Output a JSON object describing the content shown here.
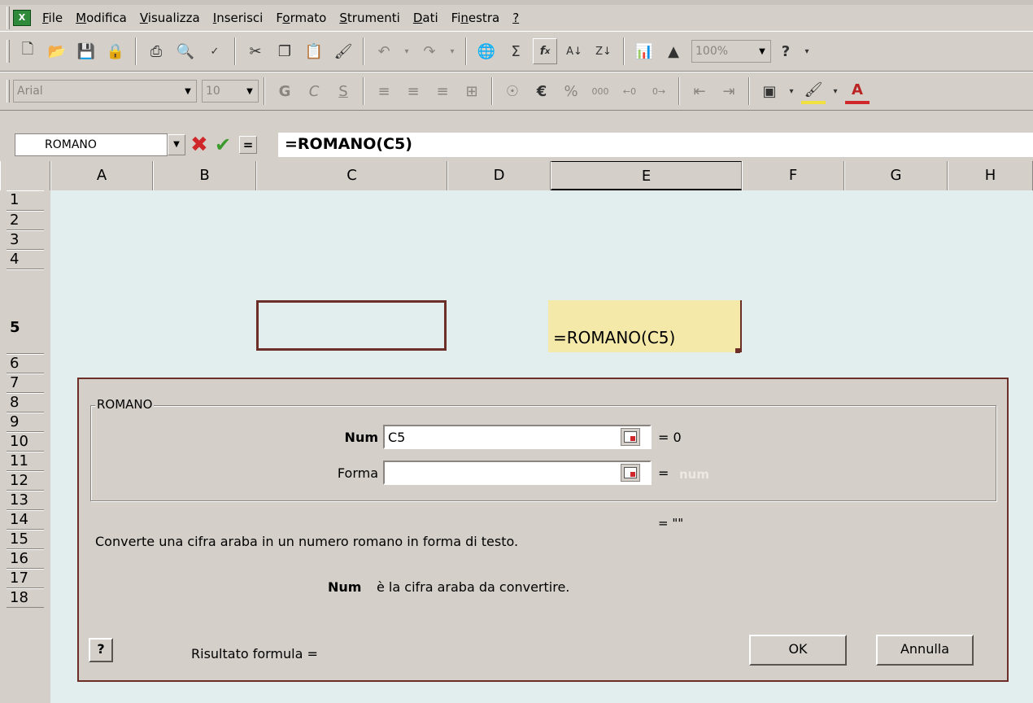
{
  "menu": {
    "items": [
      {
        "prefix": "",
        "underline": "F",
        "rest": "ile"
      },
      {
        "prefix": "",
        "underline": "M",
        "rest": "odifica"
      },
      {
        "prefix": "",
        "underline": "V",
        "rest": "isualizza"
      },
      {
        "prefix": "",
        "underline": "I",
        "rest": "nserisci"
      },
      {
        "prefix": "F",
        "underline": "o",
        "rest": "rmato"
      },
      {
        "prefix": "",
        "underline": "S",
        "rest": "trumenti"
      },
      {
        "prefix": "",
        "underline": "D",
        "rest": "ati"
      },
      {
        "prefix": "Fi",
        "underline": "n",
        "rest": "estra"
      },
      {
        "prefix": "",
        "underline": "?",
        "rest": ""
      }
    ]
  },
  "toolbar1": {
    "zoom": "100%",
    "icons": [
      "new-icon",
      "open-icon",
      "save-icon",
      "permission-icon",
      "print-icon",
      "print-preview-icon",
      "spelling-icon",
      "cut-icon",
      "copy-icon",
      "paste-icon",
      "format-painter-icon",
      "undo-icon",
      "redo-icon",
      "hyperlink-icon",
      "autosum-icon",
      "function-icon",
      "sort-ascending-icon",
      "sort-descending-icon",
      "chart-wizard-icon",
      "drawing-icon",
      "help-icon"
    ]
  },
  "toolbar2": {
    "font": "Arial",
    "size": "10",
    "bold": "G",
    "italic": "C",
    "underline": "S",
    "euro": "€",
    "percent": "%",
    "thousands": "000"
  },
  "formula_bar": {
    "name_box": "ROMANO",
    "equals": "=",
    "formula": "=ROMANO(C5)"
  },
  "grid": {
    "columns": [
      "A",
      "B",
      "C",
      "D",
      "E",
      "F",
      "G",
      "H"
    ],
    "rows": [
      "1",
      "2",
      "3",
      "4",
      "5",
      "6",
      "7",
      "8",
      "9",
      "10",
      "11",
      "12",
      "13",
      "14",
      "15",
      "16",
      "17",
      "18"
    ],
    "active_cell_text": "=ROMANO(C5)"
  },
  "dialog": {
    "group_title": "ROMANO",
    "arg1_label": "Num",
    "arg1_value": "C5",
    "arg1_result": "= 0",
    "arg2_label": "Forma",
    "arg2_value": "",
    "arg2_result_eq": "=",
    "arg2_result": "num",
    "function_result": "= \"\"",
    "description": "Converte una cifra araba in un numero romano in forma di testo.",
    "arg_help_name": "Num",
    "arg_help_text": "è la cifra araba da convertire.",
    "formula_result_label": "Risultato formula =",
    "help_button": "?",
    "ok_label": "OK",
    "cancel_label": "Annulla"
  }
}
